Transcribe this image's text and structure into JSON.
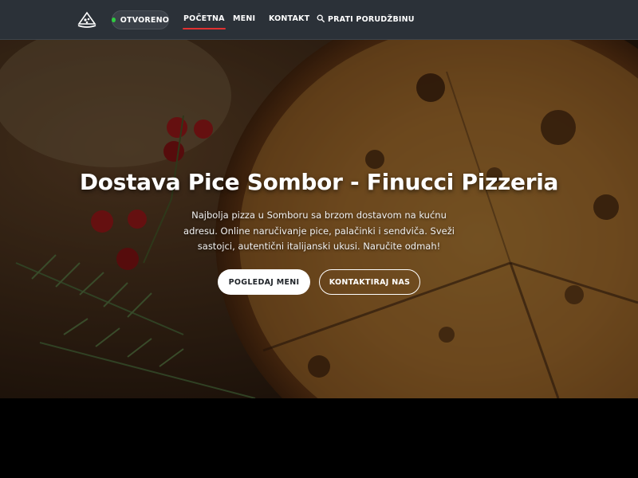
{
  "nav": {
    "logo_icon": "pizza-logo-icon",
    "status": {
      "label": "OTVORENO",
      "color": "#2ecc40"
    },
    "links": [
      {
        "label": "POČETNA",
        "active": true
      },
      {
        "label": "MENI",
        "active": false
      },
      {
        "label": "KONTAKT",
        "active": false
      }
    ],
    "track": {
      "label": "PRATI PORUDŽBINU",
      "icon": "search-icon"
    },
    "active_color": "#e03131"
  },
  "hero": {
    "title": "Dostava Pice Sombor - Finucci Pizzeria",
    "description": "Najbolja pizza u Somboru sa brzom dostavom na kućnu adresu. Online naručivanje pice, palačinki i sendviča. Sveži sastojci, autentični italijanski ukusi. Naručite odmah!",
    "primary_button": "POGLEDAJ MENI",
    "secondary_button": "KONTAKTIRAJ NAS"
  }
}
